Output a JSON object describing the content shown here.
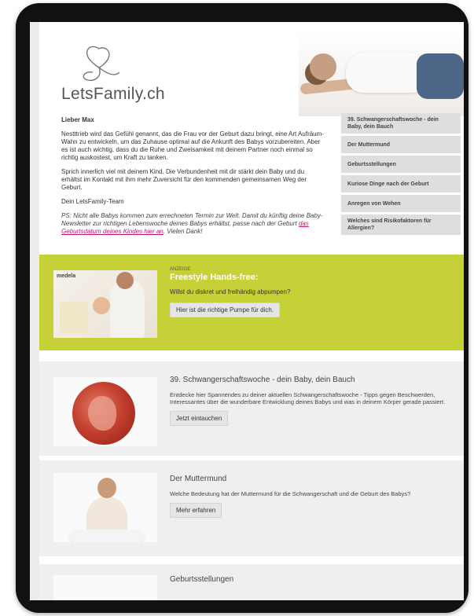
{
  "header": {
    "logo_text": "LetsFamily.ch"
  },
  "letter": {
    "greeting": "Lieber Max",
    "p1": "Nestttrieb wird das Gefühl genannt, das die Frau vor der Geburt dazu bringt, eine Art Aufräum-Wahn zu entwickeln, um das Zuhause optimal auf die Ankunft des Babys vorzubereiten. Aber es ist auch wichtig, dass du die Ruhe und Zweisamkeit mit deinem Partner noch einmal so richtig auskostest, um Kraft zu tanken.",
    "p2": "Sprich innerlich viel mit deinem Kind. Die Verbundenheit mit dir stärkt dein Baby und du erhältst im Kontakt mit ihm mehr Zuversicht für den kommenden gemeinsamen Weg der Geburt.",
    "signature": "Dein LetsFamily-Team",
    "ps_prefix": "PS: Nicht alle Babys kommen zum errechneten Termin zur Welt. Damit du künftig deine Baby-Newsletter zur richtigen Lebenswoche deines Babys erhältst, passe nach der Geburt ",
    "ps_link": "das Geburtsdatum deines Kindes hier an",
    "ps_suffix": ". Vielen Dank!"
  },
  "sidebar": {
    "items": [
      {
        "label": "39. Schwangerschaftswoche - dein Baby, dein Bauch"
      },
      {
        "label": "Der Muttermund"
      },
      {
        "label": "Geburtsstellungen"
      },
      {
        "label": "Kuriose Dinge nach der Geburt"
      },
      {
        "label": "Anregen von Wehen"
      },
      {
        "label": "Welches sind Risikofaktoren für Allergien?"
      }
    ]
  },
  "ad": {
    "label": "ANZEIGE",
    "brand": "medela",
    "title": "Freestyle Hands-free:",
    "text": "Willst du diskret und freihändig abpumpen?",
    "button": "Hier ist die richtige Pumpe für dich."
  },
  "articles": [
    {
      "title": "39. Schwangerschaftswoche - dein Baby, dein Bauch",
      "text": "Entdecke hier Spannendes zu deiner aktuellen Schwangerschaftswoche - Tipps gegen Beschwerden, Interessantes über die wunderbare Entwicklung deines Babys und was in deinem Körper gerade passiert.",
      "button": "Jetzt eintauchen"
    },
    {
      "title": "Der Muttermund",
      "text": "Welche Bedeutung hat der Muttermund für die Schwangerschaft und die Geburt des Babys?",
      "button": "Mehr erfahren"
    },
    {
      "title": "Geburtsstellungen"
    }
  ],
  "colors": {
    "ad_background": "#c6d138",
    "link": "#c2186f",
    "sidebar_item_bg": "#dedede",
    "card_bg": "#efefef"
  }
}
